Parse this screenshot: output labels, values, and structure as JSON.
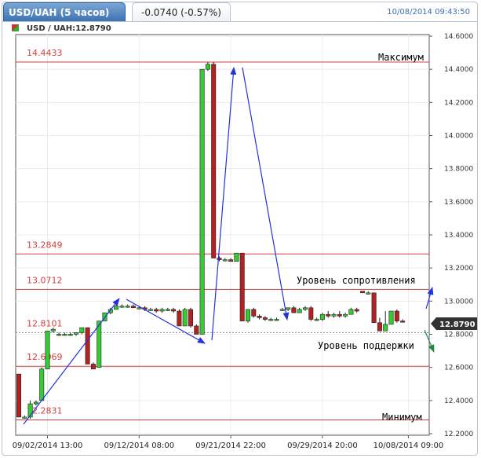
{
  "header": {
    "title": "USD/UAH (5 часов)",
    "change": "-0.0740 (-0.57%)",
    "timestamp": "10/08/2014 09:43:50"
  },
  "chart_data": {
    "type": "candlestick",
    "symbol_label": "USD / UAH:12.8790",
    "current_price": "12.8790",
    "ylim": [
      12.2,
      14.6
    ],
    "y_ticks": [
      "12.2000",
      "12.4000",
      "12.6000",
      "12.8000",
      "13.0000",
      "13.2000",
      "13.4000",
      "13.6000",
      "13.8000",
      "14.0000",
      "14.2000",
      "14.4000",
      "14.6000"
    ],
    "x_ticks": [
      {
        "label": "09/02/2014 13:00",
        "index": 5
      },
      {
        "label": "09/12/2014 08:00",
        "index": 21
      },
      {
        "label": "09/21/2014 22:00",
        "index": 37
      },
      {
        "label": "09/29/2014 20:00",
        "index": 53
      },
      {
        "label": "10/08/2014 09:00",
        "index": 68
      }
    ],
    "levels": [
      {
        "label": "14.4433",
        "value": 14.4433
      },
      {
        "label": "13.2849",
        "value": 13.2849
      },
      {
        "label": "13.0712",
        "value": 13.0712
      },
      {
        "label": "12.8101",
        "value": 12.8101
      },
      {
        "label": "12.6069",
        "value": 12.6069
      },
      {
        "label": "12.2831",
        "value": 12.2831
      }
    ],
    "annotations": {
      "max": "Максимум",
      "min": "Минимум",
      "resistance": "Уровень сопротивления",
      "support": "Уровень поддержки"
    },
    "candles": [
      {
        "o": 12.56,
        "h": 12.56,
        "l": 12.3,
        "c": 12.3
      },
      {
        "o": 12.3,
        "h": 12.31,
        "l": 12.29,
        "c": 12.3
      },
      {
        "o": 12.3,
        "h": 12.4,
        "l": 12.29,
        "c": 12.38
      },
      {
        "o": 12.38,
        "h": 12.4,
        "l": 12.37,
        "c": 12.39
      },
      {
        "o": 12.4,
        "h": 12.6,
        "l": 12.4,
        "c": 12.59
      },
      {
        "o": 12.59,
        "h": 12.82,
        "l": 12.59,
        "c": 12.82
      },
      {
        "o": 12.82,
        "h": 12.84,
        "l": 12.81,
        "c": 12.83
      },
      {
        "o": 12.8,
        "h": 12.81,
        "l": 12.79,
        "c": 12.8
      },
      {
        "o": 12.8,
        "h": 12.81,
        "l": 12.79,
        "c": 12.8
      },
      {
        "o": 12.8,
        "h": 12.81,
        "l": 12.79,
        "c": 12.8
      },
      {
        "o": 12.8,
        "h": 12.81,
        "l": 12.79,
        "c": 12.81
      },
      {
        "o": 12.81,
        "h": 12.84,
        "l": 12.8,
        "c": 12.84
      },
      {
        "o": 12.84,
        "h": 12.84,
        "l": 12.62,
        "c": 12.62
      },
      {
        "o": 12.62,
        "h": 12.63,
        "l": 12.59,
        "c": 12.59
      },
      {
        "o": 12.6,
        "h": 12.88,
        "l": 12.6,
        "c": 12.88
      },
      {
        "o": 12.88,
        "h": 12.93,
        "l": 12.88,
        "c": 12.93
      },
      {
        "o": 12.93,
        "h": 12.96,
        "l": 12.92,
        "c": 12.95
      },
      {
        "o": 12.95,
        "h": 12.98,
        "l": 12.95,
        "c": 12.97
      },
      {
        "o": 12.97,
        "h": 12.98,
        "l": 12.96,
        "c": 12.97
      },
      {
        "o": 12.97,
        "h": 12.98,
        "l": 12.96,
        "c": 12.97
      },
      {
        "o": 12.97,
        "h": 12.98,
        "l": 12.96,
        "c": 12.96
      },
      {
        "o": 12.96,
        "h": 12.97,
        "l": 12.95,
        "c": 12.96
      },
      {
        "o": 12.96,
        "h": 12.97,
        "l": 12.94,
        "c": 12.95
      },
      {
        "o": 12.95,
        "h": 12.96,
        "l": 12.94,
        "c": 12.95
      },
      {
        "o": 12.95,
        "h": 12.96,
        "l": 12.93,
        "c": 12.94
      },
      {
        "o": 12.94,
        "h": 12.96,
        "l": 12.93,
        "c": 12.95
      },
      {
        "o": 12.95,
        "h": 12.96,
        "l": 12.94,
        "c": 12.95
      },
      {
        "o": 12.95,
        "h": 12.96,
        "l": 12.93,
        "c": 12.94
      },
      {
        "o": 12.94,
        "h": 12.95,
        "l": 12.85,
        "c": 12.85
      },
      {
        "o": 12.85,
        "h": 12.96,
        "l": 12.85,
        "c": 12.95
      },
      {
        "o": 12.95,
        "h": 12.96,
        "l": 12.84,
        "c": 12.85
      },
      {
        "o": 12.85,
        "h": 12.86,
        "l": 12.8,
        "c": 12.8
      },
      {
        "o": 12.8,
        "h": 14.4,
        "l": 12.8,
        "c": 14.4
      },
      {
        "o": 14.4,
        "h": 14.4433,
        "l": 14.39,
        "c": 14.43
      },
      {
        "o": 14.43,
        "h": 14.4433,
        "l": 13.26,
        "c": 13.26
      },
      {
        "o": 13.26,
        "h": 13.27,
        "l": 13.24,
        "c": 13.25
      },
      {
        "o": 13.25,
        "h": 13.26,
        "l": 13.24,
        "c": 13.25
      },
      {
        "o": 13.25,
        "h": 13.26,
        "l": 13.24,
        "c": 13.24
      },
      {
        "o": 13.24,
        "h": 13.29,
        "l": 13.24,
        "c": 13.29
      },
      {
        "o": 13.29,
        "h": 13.29,
        "l": 12.88,
        "c": 12.88
      },
      {
        "o": 12.88,
        "h": 12.95,
        "l": 12.87,
        "c": 12.95
      },
      {
        "o": 12.95,
        "h": 12.96,
        "l": 12.9,
        "c": 12.91
      },
      {
        "o": 12.91,
        "h": 12.92,
        "l": 12.89,
        "c": 12.9
      },
      {
        "o": 12.9,
        "h": 12.91,
        "l": 12.88,
        "c": 12.89
      },
      {
        "o": 12.89,
        "h": 12.9,
        "l": 12.88,
        "c": 12.89
      },
      {
        "o": 12.89,
        "h": 12.9,
        "l": 12.88,
        "c": 12.89
      },
      {
        "o": 12.95,
        "h": 12.96,
        "l": 12.94,
        "c": 12.95
      },
      {
        "o": 12.95,
        "h": 12.96,
        "l": 12.94,
        "c": 12.96
      },
      {
        "o": 12.96,
        "h": 12.97,
        "l": 12.93,
        "c": 12.93
      },
      {
        "o": 12.93,
        "h": 12.96,
        "l": 12.93,
        "c": 12.95
      },
      {
        "o": 12.95,
        "h": 12.97,
        "l": 12.94,
        "c": 12.96
      },
      {
        "o": 12.96,
        "h": 12.97,
        "l": 12.88,
        "c": 12.89
      },
      {
        "o": 12.89,
        "h": 12.9,
        "l": 12.88,
        "c": 12.89
      },
      {
        "o": 12.89,
        "h": 12.93,
        "l": 12.88,
        "c": 12.92
      },
      {
        "o": 12.92,
        "h": 12.94,
        "l": 12.9,
        "c": 12.91
      },
      {
        "o": 12.91,
        "h": 12.93,
        "l": 12.9,
        "c": 12.92
      },
      {
        "o": 12.92,
        "h": 12.94,
        "l": 12.9,
        "c": 12.91
      },
      {
        "o": 12.91,
        "h": 12.93,
        "l": 12.9,
        "c": 12.92
      },
      {
        "o": 12.92,
        "h": 12.96,
        "l": 12.92,
        "c": 12.95
      },
      {
        "o": 12.95,
        "h": 12.96,
        "l": 12.93,
        "c": 12.94
      },
      {
        "o": 13.06,
        "h": 13.06,
        "l": 13.05,
        "c": 13.05
      },
      {
        "o": 13.05,
        "h": 13.06,
        "l": 13.04,
        "c": 13.05
      },
      {
        "o": 13.05,
        "h": 13.05,
        "l": 12.87,
        "c": 12.87
      },
      {
        "o": 12.87,
        "h": 12.9,
        "l": 12.82,
        "c": 12.82
      },
      {
        "o": 12.82,
        "h": 12.94,
        "l": 12.82,
        "c": 12.86
      },
      {
        "o": 12.86,
        "h": 12.94,
        "l": 12.86,
        "c": 12.94
      },
      {
        "o": 12.94,
        "h": 12.95,
        "l": 12.87,
        "c": 12.88
      },
      {
        "o": 12.88,
        "h": 12.89,
        "l": 12.87,
        "c": 12.879
      }
    ],
    "colors": {
      "up": "#33cc33",
      "down": "#b22222",
      "level_line": "#d44040",
      "arrow": "#2233dd",
      "arrow_down": "#228844",
      "price_tag": "#333333"
    }
  }
}
